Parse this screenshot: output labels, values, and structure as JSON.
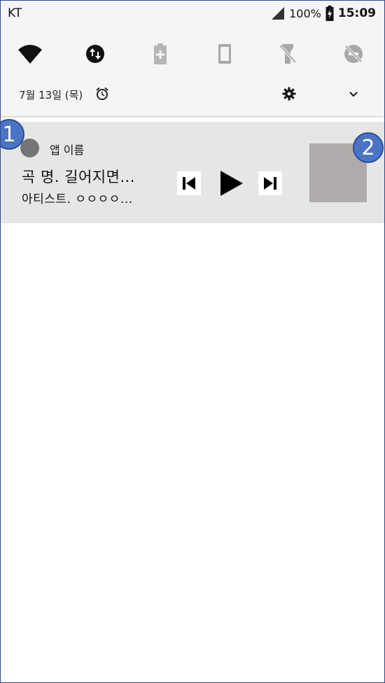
{
  "status_bar": {
    "carrier": "KT",
    "battery_percent": "100%",
    "time": "15:09"
  },
  "quick_settings": {
    "tiles": [
      {
        "icon": "wifi-icon",
        "active": true
      },
      {
        "icon": "data-transfer-icon",
        "active": true
      },
      {
        "icon": "battery-saver-icon",
        "active": false
      },
      {
        "icon": "phone-rotate-icon",
        "active": false
      },
      {
        "icon": "flashlight-off-icon",
        "active": false
      },
      {
        "icon": "do-not-disturb-off-icon",
        "active": false
      }
    ],
    "date": "7월 13일 (목)"
  },
  "notification": {
    "app_name": "앱 이름",
    "song_title": "곡 명. 길어지면...",
    "artist": "아티스트. ㅇㅇㅇㅇ...",
    "controls": [
      "previous-icon",
      "play-icon",
      "next-icon"
    ]
  },
  "annotations": [
    "1",
    "2"
  ],
  "colors": {
    "shade": "#f5f5f5",
    "notification": "#e6e6e6",
    "app_icon": "#757575",
    "album_art": "#b0aaaa",
    "badge": "#4a74c4",
    "inactive_icon": "#9e9e9e"
  }
}
